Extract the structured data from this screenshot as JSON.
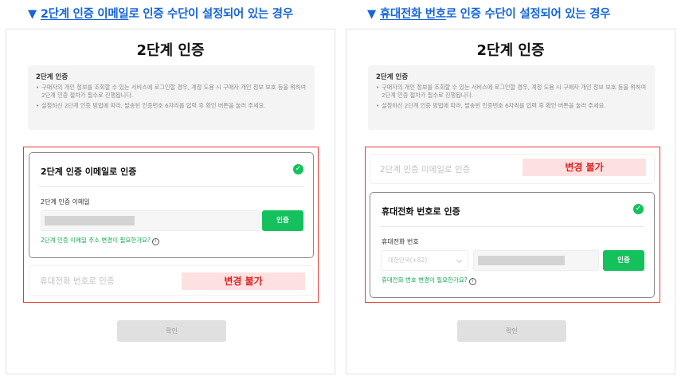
{
  "headings": {
    "left": {
      "marker": "▼",
      "underlined": "2단계 인증 이메일",
      "rest": "로 인증 수단이 설정되어 있는 경우"
    },
    "right": {
      "marker": "▼",
      "underlined": "휴대전화 번호",
      "rest": "로 인증 수단이 설정되어 있는 경우"
    }
  },
  "panel": {
    "title": "2단계 인증",
    "info_title": "2단계 인증",
    "info_lines": [
      "구매자의 개인 정보를 조회할 수 있는 서비스에 로그인할 경우, 계정 도용 시 구매자 개인 정보 보호 등을 위하여 2단계 인증 절차가 필수로 진행됩니다.",
      "설정하신 2단계 인증 방법에 따라, 발송된 인증번호 6자리를 입력 후 확인 버튼을 눌러 주세요."
    ],
    "confirm_label": "확인"
  },
  "email_method": {
    "title": "2단계 인증 이메일로 인증",
    "field_label": "2단계 인증 이메일",
    "verify_label": "인증",
    "help_link": "2단계 인증 이메일 주소 변경이 필요한가요?",
    "help_icon": "ⓘ"
  },
  "phone_method": {
    "title": "휴대전화 번호로 인증",
    "field_label": "휴대전화 번호",
    "country_value": "대한민국(+82)",
    "verify_label": "인증",
    "help_link": "휴대전화 번호 변경이 필요한가요?",
    "help_icon": "ⓘ"
  },
  "no_change_label": "변경 불가",
  "colors": {
    "accent_green": "#15c15d",
    "annotation_red": "#e53935",
    "heading_blue": "#1565d8"
  }
}
